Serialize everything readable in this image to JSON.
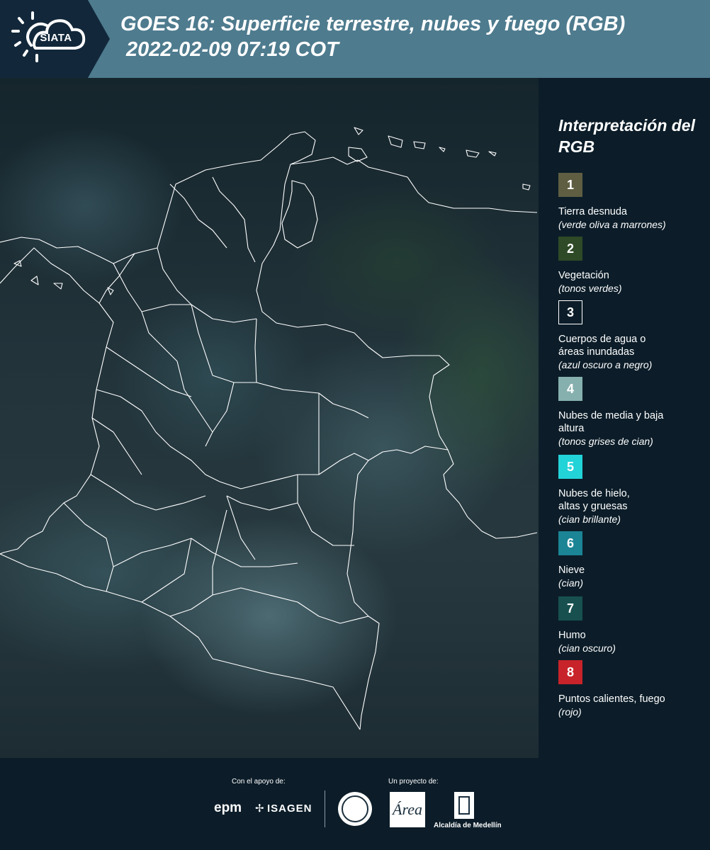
{
  "header": {
    "logo_text": "SIATA",
    "title_line1": "GOES 16: Superficie terrestre, nubes y fuego (RGB)",
    "title_line2": "2022-02-09 07:19 COT"
  },
  "legend": {
    "title": "Interpretación del RGB",
    "items": [
      {
        "number": "1",
        "label": "Tierra desnuda",
        "sub": "(verde oliva a marrones)",
        "color": "#5f5e42"
      },
      {
        "number": "2",
        "label": "Vegetación",
        "sub": "(tonos verdes)",
        "color": "#2e4a26"
      },
      {
        "number": "3",
        "label": "Cuerpos de agua o áreas inundadas",
        "sub": "(azul oscuro a negro)",
        "color": "#0c1d29"
      },
      {
        "number": "4",
        "label": "Nubes de media y baja altura",
        "sub": "(tonos grises de cian)",
        "color": "#86b0ae"
      },
      {
        "number": "5",
        "label": "Nubes de hielo, altas y gruesas",
        "sub": "(cian brillante)",
        "color": "#22d3d8"
      },
      {
        "number": "6",
        "label": "Nieve",
        "sub": "(cian)",
        "color": "#1b8495"
      },
      {
        "number": "7",
        "label": "Humo",
        "sub": "(cian oscuro)",
        "color": "#17504f"
      },
      {
        "number": "8",
        "label": "Puntos calientes, fuego",
        "sub": "(rojo)",
        "color": "#c8232a"
      }
    ]
  },
  "footer": {
    "support_label": "Con el apoyo de:",
    "project_label": "Un proyecto de:",
    "epm": "epm",
    "isagen": "ISAGEN",
    "area_logo": "Área",
    "alcaldia": "Alcaldía de Medellín"
  }
}
